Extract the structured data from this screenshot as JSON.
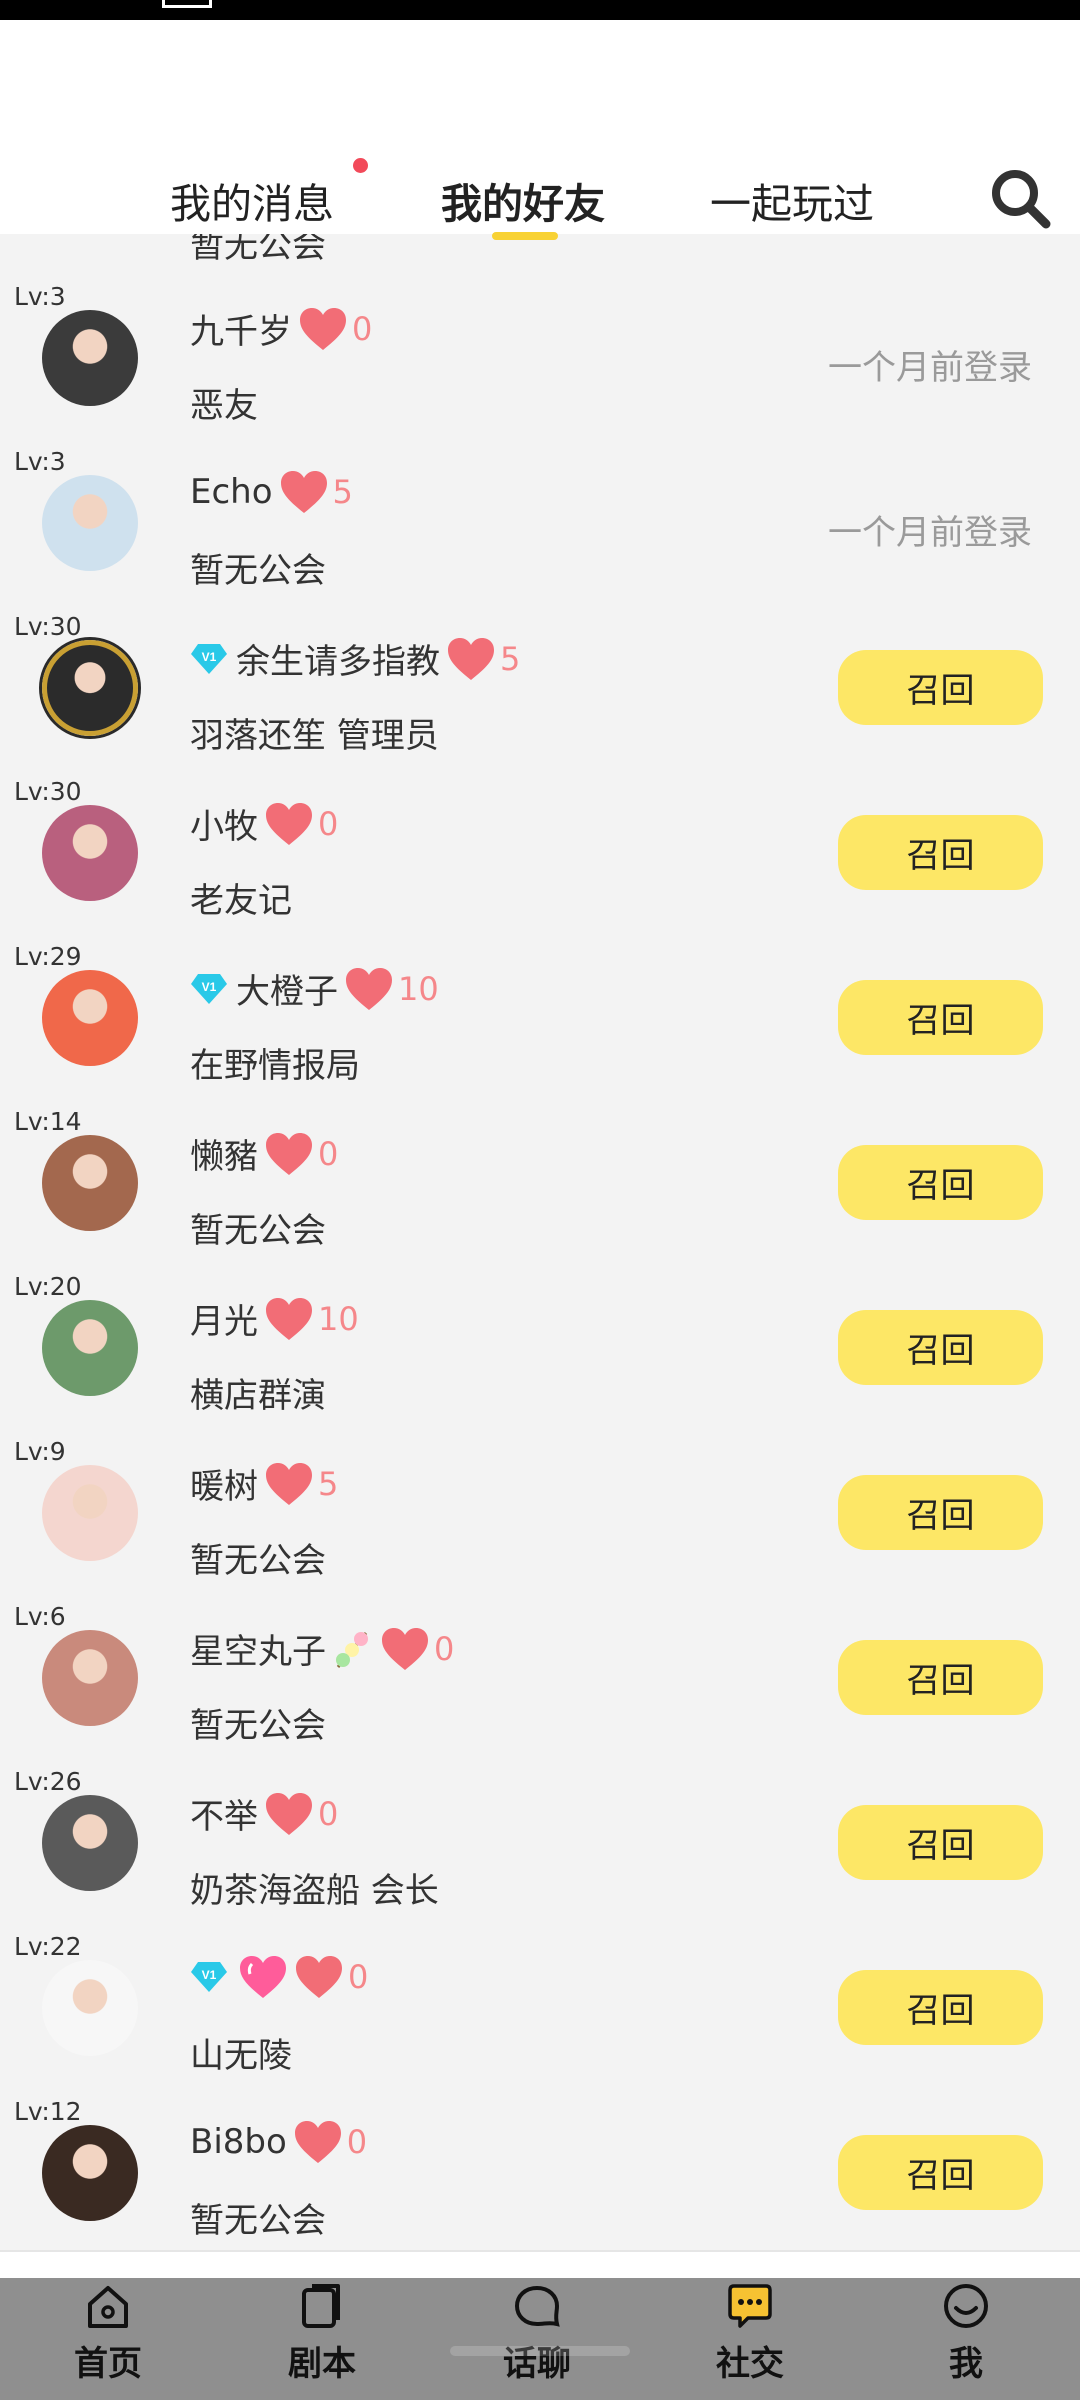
{
  "tabs": {
    "messages": "我的消息",
    "friends": "我的好友",
    "played": "一起玩过"
  },
  "list_peek_text": "暂无公会",
  "recall_label": "召回",
  "friends": [
    {
      "level": "Lv:3",
      "name": "九千岁",
      "vip": false,
      "hearts": "0",
      "guild": "恶友",
      "status": "一个月前登录",
      "avatar": "#3b3b3b"
    },
    {
      "level": "Lv:3",
      "name": "Echo",
      "vip": false,
      "hearts": "5",
      "guild": "暂无公会",
      "status": "一个月前登录",
      "avatar": "#cfe1ee"
    },
    {
      "level": "Lv:30",
      "name": "余生请多指教",
      "vip": true,
      "hearts": "5",
      "guild": "羽落还笙 管理员",
      "status": "",
      "avatar": "#2b2b2b"
    },
    {
      "level": "Lv:30",
      "name": "小牧",
      "vip": false,
      "hearts": "0",
      "guild": "老友记",
      "status": "",
      "avatar": "#b9607e"
    },
    {
      "level": "Lv:29",
      "name": "大橙子",
      "vip": true,
      "hearts": "10",
      "guild": "在野情报局",
      "status": "",
      "avatar": "#f0684a"
    },
    {
      "level": "Lv:14",
      "name": "懒豬",
      "vip": false,
      "hearts": "0",
      "guild": "暂无公会",
      "status": "",
      "avatar": "#a3684e"
    },
    {
      "level": "Lv:20",
      "name": "月光",
      "vip": false,
      "hearts": "10",
      "guild": "横店群演",
      "status": "",
      "avatar": "#6d9a6b"
    },
    {
      "level": "Lv:9",
      "name": "暖树",
      "vip": false,
      "hearts": "5",
      "guild": "暂无公会",
      "status": "",
      "avatar": "#f4d6cf"
    },
    {
      "level": "Lv:6",
      "name": "星空丸子",
      "vip": false,
      "sticker": true,
      "hearts": "0",
      "guild": "暂无公会",
      "status": "",
      "avatar": "#c98a7c"
    },
    {
      "level": "Lv:26",
      "name": "不举",
      "vip": false,
      "hearts": "0",
      "guild": "奶茶海盗船 会长",
      "status": "",
      "avatar": "#5a5a5a"
    },
    {
      "level": "Lv:22",
      "name": "",
      "vip": true,
      "pink_heart": true,
      "hearts": "0",
      "guild": "山无陵",
      "status": "",
      "avatar": "#f7f7f7"
    },
    {
      "level": "Lv:12",
      "name": "Bi8bo",
      "vip": false,
      "hearts": "0",
      "guild": "暂无公会",
      "status": "",
      "avatar": "#3a2a22"
    }
  ],
  "nav": [
    {
      "label": "首页",
      "icon": "home-icon"
    },
    {
      "label": "剧本",
      "icon": "script-icon"
    },
    {
      "label": "话聊",
      "icon": "chat-icon"
    },
    {
      "label": "社交",
      "icon": "social-icon"
    },
    {
      "label": "我",
      "icon": "profile-icon"
    }
  ],
  "colors": {
    "accent_yellow": "#fde766",
    "tab_underline": "#f8d234",
    "heart": "#f26d76",
    "heart_count": "#f5878a",
    "unread_dot": "#f24a5a",
    "nav_bg": "#8f8f8f"
  }
}
